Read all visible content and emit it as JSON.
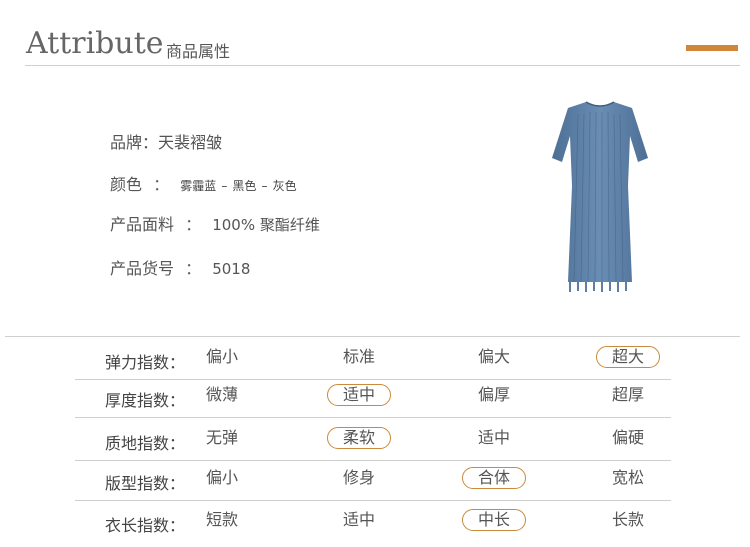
{
  "header": {
    "title_en": "Attribute",
    "title_cn": "商品属性",
    "accent_color": "#d2863a"
  },
  "attributes": {
    "brand": {
      "label": "品牌：",
      "value": "天裴褶皱"
    },
    "color": {
      "label": "颜色",
      "sep": "：",
      "values": [
        "雾霾蓝",
        "黑色",
        "灰色"
      ],
      "dash": "–"
    },
    "fabric": {
      "label": "产品面料",
      "sep": "：",
      "value": "100% 聚酯纤维"
    },
    "sku": {
      "label": "产品货号",
      "sep": "：",
      "value": "5018"
    }
  },
  "product_image": {
    "alt": "dress-photo",
    "color": "#5d7fa3"
  },
  "index_table": {
    "rows": [
      {
        "label": "弹力指数：",
        "options": [
          "偏小",
          "标准",
          "偏大",
          "超大"
        ],
        "selected": 3
      },
      {
        "label": "厚度指数：",
        "options": [
          "微薄",
          "适中",
          "偏厚",
          "超厚"
        ],
        "selected": 1
      },
      {
        "label": "质地指数：",
        "options": [
          "无弹",
          "柔软",
          "适中",
          "偏硬"
        ],
        "selected": 1
      },
      {
        "label": "版型指数：",
        "options": [
          "偏小",
          "修身",
          "合体",
          "宽松"
        ],
        "selected": 2
      },
      {
        "label": "衣长指数：",
        "options": [
          "短款",
          "适中",
          "中长",
          "长款"
        ],
        "selected": 2
      }
    ]
  }
}
